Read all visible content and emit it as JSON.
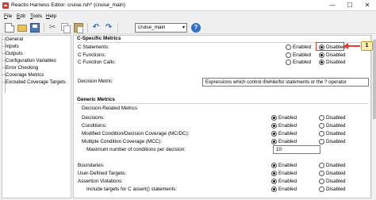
{
  "window": {
    "title": "Reactis Harness Editor: cruise.rsh* (cruise_main)",
    "minimize": "—",
    "maximize": "☐",
    "close": "✕"
  },
  "menu": [
    {
      "underline": "F",
      "rest": "ile"
    },
    {
      "underline": "E",
      "rest": "dit"
    },
    {
      "underline": "T",
      "rest": "ools"
    },
    {
      "underline": "H",
      "rest": "elp"
    }
  ],
  "toolbar": {
    "icons": [
      "new-file-icon",
      "open-folder-icon",
      "save-icon",
      "cut-icon",
      "copy-icon",
      "paste-icon",
      "undo-icon",
      "redo-icon",
      "help-icon"
    ],
    "undo_glyph": "↶",
    "redo_glyph": "↷",
    "cut_glyph": "✂",
    "help_glyph": "?",
    "function_select": "cruise_main",
    "chevron_glyph": "▾"
  },
  "tree": {
    "items": [
      "General",
      "Inputs",
      "Outputs",
      "Configuration Variables",
      "Error Checking",
      "Coverage Metrics",
      "Excluded Coverage Targets"
    ]
  },
  "panel": {
    "c_specific": {
      "heading": "C-Specific Metrics",
      "rows": [
        {
          "label": "C Statements:",
          "enabled": "Enabled",
          "disabled": "Disabled",
          "selected": "disabled"
        },
        {
          "label": "C Functions:",
          "enabled": "Enabled",
          "disabled": "Disabled",
          "selected": "disabled"
        },
        {
          "label": "C Function Calls:",
          "enabled": "Enabled",
          "disabled": "Disabled",
          "selected": "disabled"
        }
      ],
      "decision_metric_label": "Decision Metric:",
      "decision_metric_value": "Expressions which control if/while/for statements or the ? operator"
    },
    "generic": {
      "heading": "Generic Metrics",
      "subheading": "Decision-Related Metrics",
      "rows": [
        {
          "label": "Decisions:",
          "enabled": "Enabled",
          "disabled": "Disabled",
          "selected": "enabled"
        },
        {
          "label": "Conditions:",
          "enabled": "Enabled",
          "disabled": "Disabled",
          "selected": "enabled"
        },
        {
          "label": "Modified Condition/Decision Coverage (MC/DC):",
          "enabled": "Enabled",
          "disabled": "Disabled",
          "selected": "enabled"
        },
        {
          "label": "Multiple Condition Coverage (MCC):",
          "enabled": "Enabled",
          "disabled": "Disabled",
          "selected": "enabled"
        }
      ],
      "max_conditions_label": "Maximum number of conditions per decision:",
      "max_conditions_value": "10",
      "other_rows": [
        {
          "label": "Boundaries:",
          "enabled": "Enabled",
          "disabled": "Disabled",
          "selected": "enabled"
        },
        {
          "label": "User-Defined Targets:",
          "enabled": "Enabled",
          "disabled": "Disabled",
          "selected": "enabled"
        },
        {
          "label": "Assertion Violations:",
          "enabled": "Enabled",
          "disabled": "Disabled",
          "selected": "enabled"
        },
        {
          "label": "Include targets for C assert() statements:",
          "enabled": "Enabled",
          "disabled": "Disabled",
          "selected": "enabled"
        }
      ]
    }
  },
  "callout": {
    "number": "1",
    "color": "#e33b2e"
  }
}
